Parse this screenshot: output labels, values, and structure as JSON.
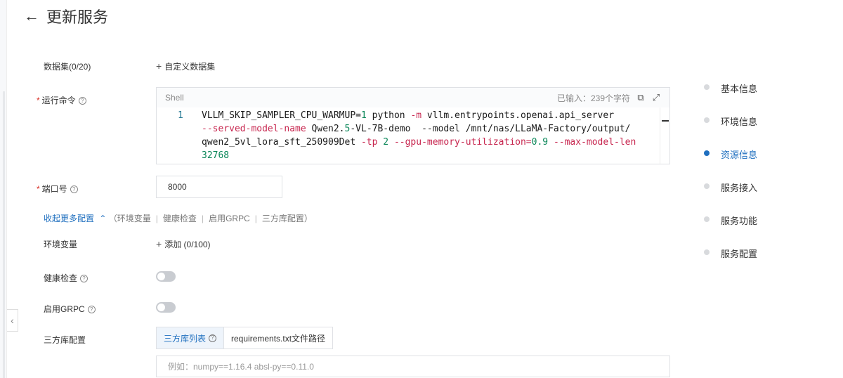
{
  "header": {
    "back_icon": "←",
    "title": "更新服务"
  },
  "dataset": {
    "label": "数据集(0/20)",
    "add_label": "自定义数据集"
  },
  "command": {
    "label": "运行命令",
    "editor": {
      "language": "Shell",
      "char_count": "已输入：239个字符",
      "line_number": "1",
      "code_lines": [
        [
          [
            "VLLM_SKIP_SAMPLER_CPU_WARMUP=",
            ""
          ],
          [
            "1",
            "num"
          ],
          [
            " python ",
            ""
          ],
          [
            "-m",
            "flag"
          ],
          [
            " vllm.entrypoints.openai.api_server",
            ""
          ]
        ],
        [
          [
            "--served-model-name",
            "flag"
          ],
          [
            " Qwen2.",
            ""
          ],
          [
            "5",
            "num"
          ],
          [
            "-VL-7B-demo  --model /mnt/nas/LLaMA-Factory/output/",
            ""
          ]
        ],
        [
          [
            "qwen2_5vl_lora_sft_250909Det ",
            ""
          ],
          [
            "-tp",
            "flag"
          ],
          [
            " ",
            ""
          ],
          [
            "2",
            "num"
          ],
          [
            " ",
            ""
          ],
          [
            "--gpu-memory-utilization=",
            "flag"
          ],
          [
            "0.9",
            "num"
          ],
          [
            " ",
            ""
          ],
          [
            "--max-model-len",
            "flag"
          ]
        ],
        [
          [
            "32768",
            "num"
          ]
        ]
      ]
    }
  },
  "port": {
    "label": "端口号",
    "value": "8000"
  },
  "more_config": {
    "toggle_label": "收起更多配置",
    "paren_open": "（",
    "items": [
      "环境变量",
      "健康检查",
      "启用GRPC",
      "三方库配置"
    ],
    "paren_close": "）"
  },
  "env": {
    "label": "环境变量",
    "add_label": "添加 (0/100)"
  },
  "health": {
    "label": "健康检查",
    "enabled": false
  },
  "grpc": {
    "label": "启用GRPC",
    "enabled": false
  },
  "third_party": {
    "label": "三方库配置",
    "tabs": [
      "三方库列表",
      "requirements.txt文件路径"
    ],
    "active_tab": 0,
    "placeholder": "例如：numpy==1.16.4 absl-py==0.11.0"
  },
  "anchor_nav": {
    "items": [
      "基本信息",
      "环境信息",
      "资源信息",
      "服务接入",
      "服务功能",
      "服务配置"
    ],
    "active_index": 2
  },
  "colors": {
    "accent": "#1f6fbf",
    "required": "#d93026"
  }
}
